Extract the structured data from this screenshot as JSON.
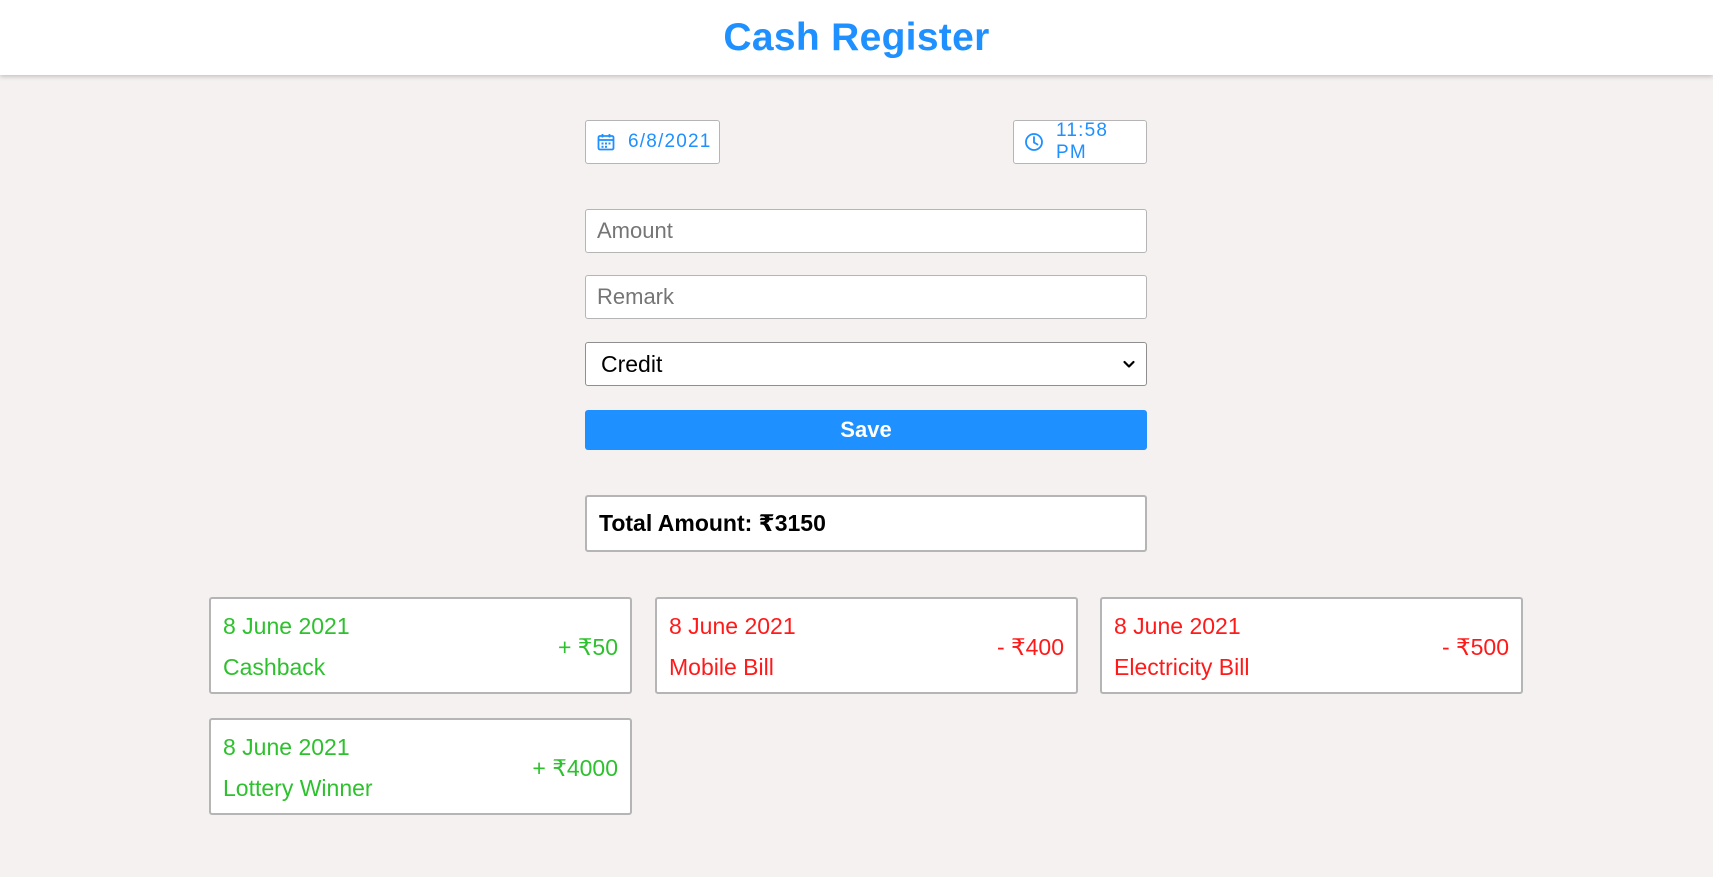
{
  "app": {
    "title": "Cash Register"
  },
  "datetime": {
    "date": "6/8/2021",
    "time": "11:58 PM"
  },
  "form": {
    "amount_placeholder": "Amount",
    "remark_placeholder": "Remark",
    "type_selected": "Credit",
    "save_label": "Save"
  },
  "summary": {
    "total_text": "Total Amount: ₹3150"
  },
  "entries": [
    {
      "date": "8 June 2021",
      "remark": "Cashback",
      "amount": "+ ₹50",
      "type": "credit"
    },
    {
      "date": "8 June 2021",
      "remark": "Mobile Bill",
      "amount": "- ₹400",
      "type": "debit"
    },
    {
      "date": "8 June 2021",
      "remark": "Electricity Bill",
      "amount": "- ₹500",
      "type": "debit"
    },
    {
      "date": "8 June 2021",
      "remark": "Lottery Winner",
      "amount": "+ ₹4000",
      "type": "credit"
    }
  ],
  "colors": {
    "accent": "#1e90ff",
    "credit": "#2ec12e",
    "debit": "#ff1a1a",
    "background": "#f4f1f0"
  }
}
